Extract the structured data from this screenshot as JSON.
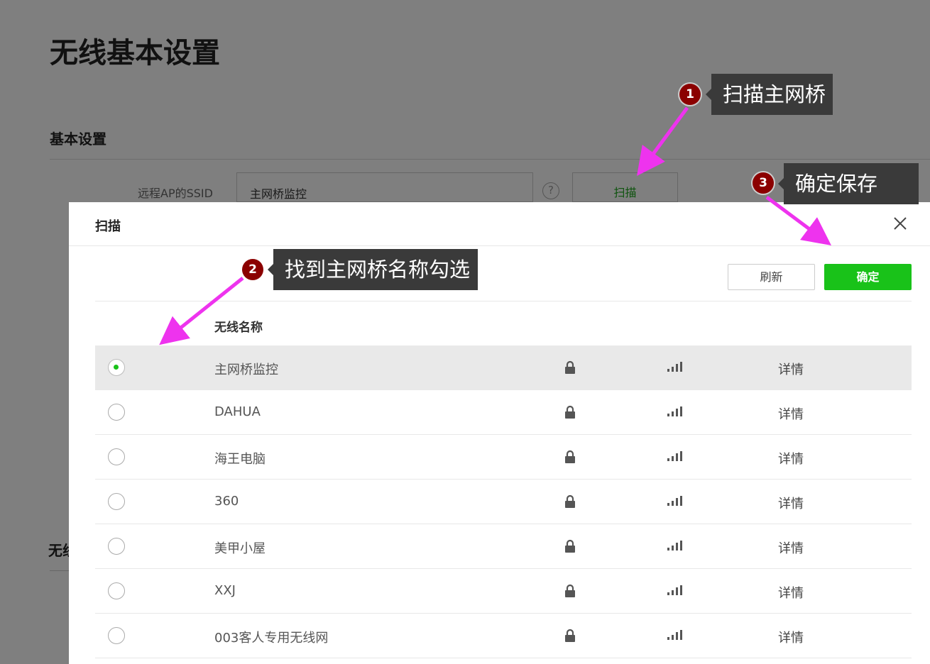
{
  "page": {
    "title": "无线基本设置",
    "section_title": "基本设置",
    "ssid_label": "远程AP的SSID",
    "ssid_value": "主网桥监控",
    "help_symbol": "?",
    "scan_button": "扫描",
    "cut_section_label": "无线"
  },
  "modal": {
    "title": "扫描",
    "refresh_button": "刷新",
    "confirm_button": "确定",
    "column_name": "无线名称",
    "rows": [
      {
        "name": "主网桥监控",
        "selected": true,
        "detail": "详情",
        "locked": true
      },
      {
        "name": "DAHUA",
        "selected": false,
        "detail": "详情",
        "locked": true
      },
      {
        "name": "海王电脑",
        "selected": false,
        "detail": "详情",
        "locked": true
      },
      {
        "name": "360",
        "selected": false,
        "detail": "详情",
        "locked": true
      },
      {
        "name": "美甲小屋",
        "selected": false,
        "detail": "详情",
        "locked": true
      },
      {
        "name": "XXJ",
        "selected": false,
        "detail": "详情",
        "locked": true
      },
      {
        "name": "003客人专用无线网",
        "selected": false,
        "detail": "详情",
        "locked": true
      }
    ]
  },
  "annotations": [
    {
      "number": "1",
      "text": "扫描主网桥"
    },
    {
      "number": "2",
      "text": "找到主网桥名称勾选"
    },
    {
      "number": "3",
      "text": "确定保存"
    }
  ],
  "colors": {
    "accent_green": "#19c219",
    "annotation_marker": "#8b0000",
    "arrow": "#ee33ee"
  }
}
